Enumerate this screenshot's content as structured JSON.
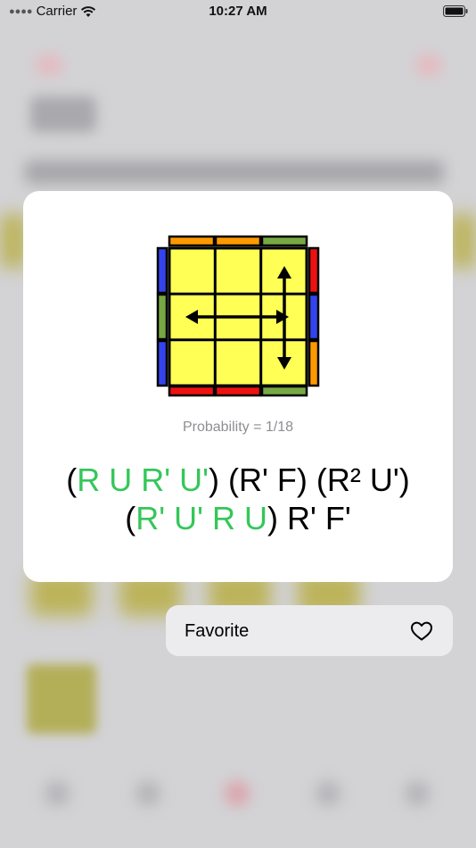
{
  "status_bar": {
    "carrier": "Carrier",
    "time": "10:27 AM"
  },
  "preview": {
    "probability": "Probability = 1/18",
    "algorithm": {
      "line1": [
        {
          "text": "(",
          "color": "black"
        },
        {
          "text": "R U R' U'",
          "color": "green"
        },
        {
          "text": ") (R' F) (R² U')",
          "color": "black"
        }
      ],
      "line2": [
        {
          "text": "(",
          "color": "black"
        },
        {
          "text": "R' U' R U",
          "color": "green"
        },
        {
          "text": ") R' F'",
          "color": "black"
        }
      ]
    }
  },
  "menu": {
    "favorite_label": "Favorite",
    "favorite_icon": "heart-icon"
  },
  "colors": {
    "yellow": "#ffff55",
    "orange": "#ff9900",
    "green": "#77a844",
    "red": "#ee1111",
    "blue": "#3344ee",
    "accent_green": "#34c759"
  }
}
